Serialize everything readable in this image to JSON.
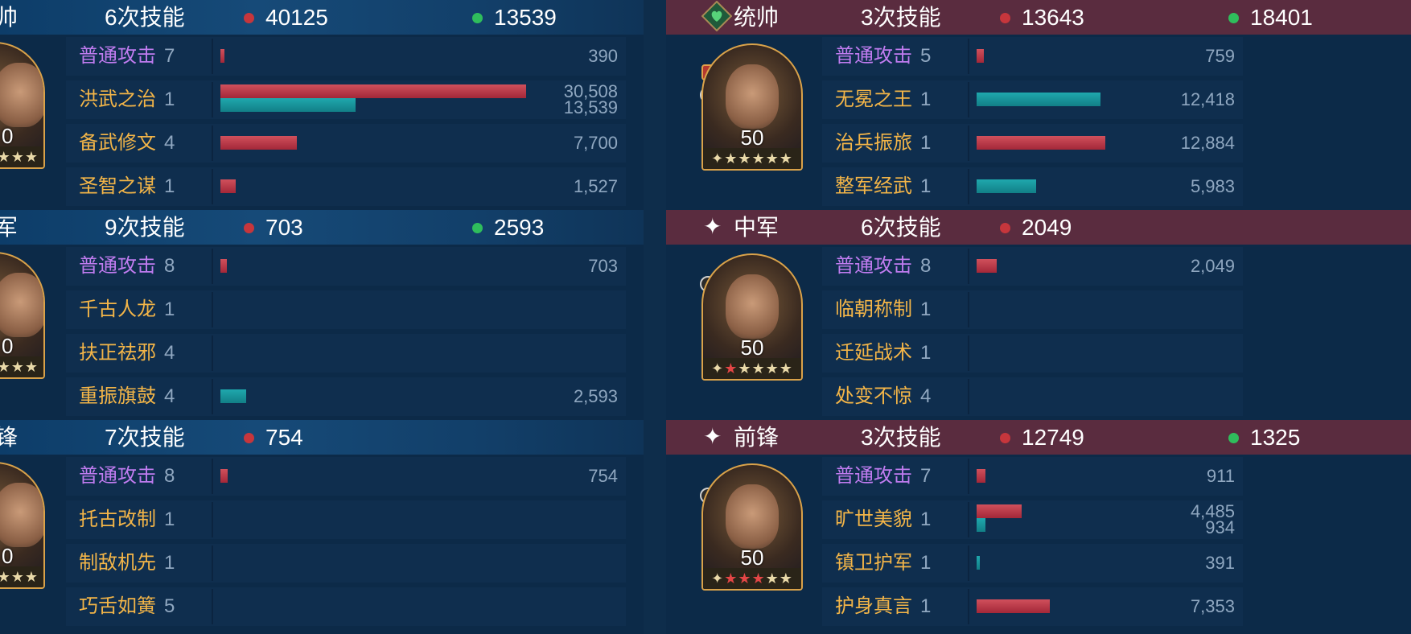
{
  "colors": {
    "red_bar": "#c0384a",
    "teal_bar": "#199aa0",
    "red_dot": "#c6363c",
    "green_dot": "#2fbd5c",
    "skill_name": "#f3b548",
    "basic_attack": "#c07cf0"
  },
  "left": {
    "sections": [
      {
        "role": "帅",
        "skills_label": "6次技能",
        "red_total": "40125",
        "green_total": "13539",
        "portrait": {
          "level": "0",
          "stars": "★★★"
        },
        "rows": [
          {
            "name": "普通攻击",
            "count": "7",
            "values": [
              "390"
            ]
          },
          {
            "name": "洪武之治",
            "count": "1",
            "values": [
              "30,508",
              "13,539"
            ]
          },
          {
            "name": "备武修文",
            "count": "4",
            "values": [
              "7,700"
            ]
          },
          {
            "name": "圣智之谋",
            "count": "1",
            "values": [
              "1,527"
            ]
          }
        ]
      },
      {
        "role": "军",
        "skills_label": "9次技能",
        "red_total": "703",
        "green_total": "2593",
        "portrait": {
          "level": "0",
          "stars": "★★★"
        },
        "rows": [
          {
            "name": "普通攻击",
            "count": "8",
            "values": [
              "703"
            ]
          },
          {
            "name": "千古人龙",
            "count": "1",
            "values": []
          },
          {
            "name": "扶正祛邪",
            "count": "4",
            "values": []
          },
          {
            "name": "重振旗鼓",
            "count": "4",
            "values": [
              "2,593"
            ]
          }
        ]
      },
      {
        "role": "锋",
        "skills_label": "7次技能",
        "red_total": "754",
        "green_total": "",
        "portrait": {
          "level": "0",
          "stars": "★★★"
        },
        "rows": [
          {
            "name": "普通攻击",
            "count": "8",
            "values": [
              "754"
            ]
          },
          {
            "name": "托古改制",
            "count": "1",
            "values": []
          },
          {
            "name": "制敌机先",
            "count": "1",
            "values": []
          },
          {
            "name": "巧舌如簧",
            "count": "5",
            "values": []
          }
        ]
      }
    ]
  },
  "right": {
    "sections": [
      {
        "role": "统帅",
        "skills_label": "3次技能",
        "red_total": "13643",
        "green_total": "18401",
        "portrait": {
          "level": "50",
          "stars": "✦★★★★★"
        },
        "rows": [
          {
            "name": "普通攻击",
            "count": "5",
            "values": [
              "759"
            ]
          },
          {
            "name": "无冕之王",
            "count": "1",
            "values": [
              "12,418"
            ]
          },
          {
            "name": "治兵振旅",
            "count": "1",
            "values": [
              "12,884"
            ]
          },
          {
            "name": "整军经武",
            "count": "1",
            "values": [
              "5,983"
            ]
          }
        ]
      },
      {
        "role": "中军",
        "skills_label": "6次技能",
        "red_total": "2049",
        "green_total": "",
        "portrait": {
          "level": "50",
          "stars_prefix": "✦",
          "stars_red": "★",
          "stars_rest": "★★★★"
        },
        "rows": [
          {
            "name": "普通攻击",
            "count": "8",
            "values": [
              "2,049"
            ]
          },
          {
            "name": "临朝称制",
            "count": "1",
            "values": []
          },
          {
            "name": "迁延战术",
            "count": "1",
            "values": []
          },
          {
            "name": "处变不惊",
            "count": "4",
            "values": []
          }
        ]
      },
      {
        "role": "前锋",
        "skills_label": "3次技能",
        "red_total": "12749",
        "green_total": "1325",
        "portrait": {
          "level": "50",
          "stars_prefix": "✦",
          "stars_red": "★★★",
          "stars_rest": "★★"
        },
        "rows": [
          {
            "name": "普通攻击",
            "count": "7",
            "values": [
              "911"
            ]
          },
          {
            "name": "旷世美貌",
            "count": "1",
            "values": [
              "4,485",
              "934"
            ]
          },
          {
            "name": "镇卫护军",
            "count": "1",
            "values": [
              "391"
            ]
          },
          {
            "name": "护身真言",
            "count": "1",
            "values": [
              "7,353"
            ]
          }
        ]
      }
    ],
    "star_glyph": "✦"
  }
}
